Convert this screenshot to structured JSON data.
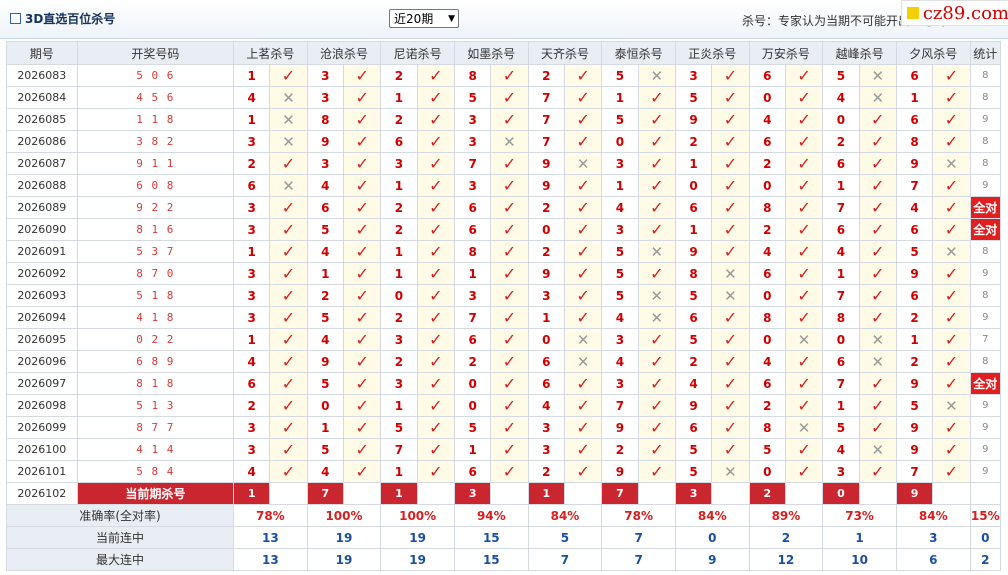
{
  "header": {
    "title": "3D直选百位杀号",
    "select_value": "近20期",
    "note": "杀号：专家认为当期不可能开出的号码",
    "logo_text": "cz89.com"
  },
  "columns": {
    "period": "期号",
    "draw": "开奖号码",
    "experts": [
      "上茗杀号",
      "沧浪杀号",
      "尼诺杀号",
      "如墨杀号",
      "天齐杀号",
      "泰恒杀号",
      "正炎杀号",
      "万安杀号",
      "越峰杀号",
      "夕风杀号"
    ],
    "count": "统计"
  },
  "rows": [
    {
      "period": "2026083",
      "draw": "5 0 6",
      "kills": [
        "1",
        "3",
        "2",
        "8",
        "2",
        "5",
        "3",
        "6",
        "5",
        "6"
      ],
      "hits": [
        1,
        1,
        1,
        1,
        1,
        0,
        1,
        1,
        0,
        1
      ],
      "count": "8"
    },
    {
      "period": "2026084",
      "draw": "4 5 6",
      "kills": [
        "4",
        "3",
        "1",
        "5",
        "7",
        "1",
        "5",
        "0",
        "4",
        "1"
      ],
      "hits": [
        0,
        1,
        1,
        1,
        1,
        1,
        1,
        1,
        0,
        1
      ],
      "count": "8"
    },
    {
      "period": "2026085",
      "draw": "1 1 8",
      "kills": [
        "1",
        "8",
        "2",
        "3",
        "7",
        "5",
        "9",
        "4",
        "0",
        "6"
      ],
      "hits": [
        0,
        1,
        1,
        1,
        1,
        1,
        1,
        1,
        1,
        1
      ],
      "count": "9"
    },
    {
      "period": "2026086",
      "draw": "3 8 2",
      "kills": [
        "3",
        "9",
        "6",
        "3",
        "7",
        "0",
        "2",
        "6",
        "2",
        "8"
      ],
      "hits": [
        0,
        1,
        1,
        0,
        1,
        1,
        1,
        1,
        1,
        1
      ],
      "count": "8"
    },
    {
      "period": "2026087",
      "draw": "9 1 1",
      "kills": [
        "2",
        "3",
        "3",
        "7",
        "9",
        "3",
        "1",
        "2",
        "6",
        "9"
      ],
      "hits": [
        1,
        1,
        1,
        1,
        0,
        1,
        1,
        1,
        1,
        0
      ],
      "count": "8"
    },
    {
      "period": "2026088",
      "draw": "6 0 8",
      "kills": [
        "6",
        "4",
        "1",
        "3",
        "9",
        "1",
        "0",
        "0",
        "1",
        "7"
      ],
      "hits": [
        0,
        1,
        1,
        1,
        1,
        1,
        1,
        1,
        1,
        1
      ],
      "count": "9"
    },
    {
      "period": "2026089",
      "draw": "9 2 2",
      "kills": [
        "3",
        "6",
        "2",
        "6",
        "2",
        "4",
        "6",
        "8",
        "7",
        "4"
      ],
      "hits": [
        1,
        1,
        1,
        1,
        1,
        1,
        1,
        1,
        1,
        1
      ],
      "count": "全对",
      "full": true
    },
    {
      "period": "2026090",
      "draw": "8 1 6",
      "kills": [
        "3",
        "5",
        "2",
        "6",
        "0",
        "3",
        "1",
        "2",
        "6",
        "6"
      ],
      "hits": [
        1,
        1,
        1,
        1,
        1,
        1,
        1,
        1,
        1,
        1
      ],
      "count": "全对",
      "full": true
    },
    {
      "period": "2026091",
      "draw": "5 3 7",
      "kills": [
        "1",
        "4",
        "1",
        "8",
        "2",
        "5",
        "9",
        "4",
        "4",
        "5"
      ],
      "hits": [
        1,
        1,
        1,
        1,
        1,
        0,
        1,
        1,
        1,
        0
      ],
      "count": "8"
    },
    {
      "period": "2026092",
      "draw": "8 7 0",
      "kills": [
        "3",
        "1",
        "1",
        "1",
        "9",
        "5",
        "8",
        "6",
        "1",
        "9"
      ],
      "hits": [
        1,
        1,
        1,
        1,
        1,
        1,
        0,
        1,
        1,
        1
      ],
      "count": "9"
    },
    {
      "period": "2026093",
      "draw": "5 1 8",
      "kills": [
        "3",
        "2",
        "0",
        "3",
        "3",
        "5",
        "5",
        "0",
        "7",
        "6"
      ],
      "hits": [
        1,
        1,
        1,
        1,
        1,
        0,
        0,
        1,
        1,
        1
      ],
      "count": "8"
    },
    {
      "period": "2026094",
      "draw": "4 1 8",
      "kills": [
        "3",
        "5",
        "2",
        "7",
        "1",
        "4",
        "6",
        "8",
        "8",
        "2"
      ],
      "hits": [
        1,
        1,
        1,
        1,
        1,
        0,
        1,
        1,
        1,
        1
      ],
      "count": "9"
    },
    {
      "period": "2026095",
      "draw": "0 2 2",
      "kills": [
        "1",
        "4",
        "3",
        "6",
        "0",
        "3",
        "5",
        "0",
        "0",
        "1"
      ],
      "hits": [
        1,
        1,
        1,
        1,
        0,
        1,
        1,
        0,
        0,
        1
      ],
      "count": "7"
    },
    {
      "period": "2026096",
      "draw": "6 8 9",
      "kills": [
        "4",
        "9",
        "2",
        "2",
        "6",
        "4",
        "2",
        "4",
        "6",
        "2"
      ],
      "hits": [
        1,
        1,
        1,
        1,
        0,
        1,
        1,
        1,
        0,
        1
      ],
      "count": "8"
    },
    {
      "period": "2026097",
      "draw": "8 1 8",
      "kills": [
        "6",
        "5",
        "3",
        "0",
        "6",
        "3",
        "4",
        "6",
        "7",
        "9"
      ],
      "hits": [
        1,
        1,
        1,
        1,
        1,
        1,
        1,
        1,
        1,
        1
      ],
      "count": "全对",
      "full": true
    },
    {
      "period": "2026098",
      "draw": "5 1 3",
      "kills": [
        "2",
        "0",
        "1",
        "0",
        "4",
        "7",
        "9",
        "2",
        "1",
        "5"
      ],
      "hits": [
        1,
        1,
        1,
        1,
        1,
        1,
        1,
        1,
        1,
        0
      ],
      "count": "9"
    },
    {
      "period": "2026099",
      "draw": "8 7 7",
      "kills": [
        "3",
        "1",
        "5",
        "5",
        "3",
        "9",
        "6",
        "8",
        "5",
        "9"
      ],
      "hits": [
        1,
        1,
        1,
        1,
        1,
        1,
        1,
        0,
        1,
        1
      ],
      "count": "9"
    },
    {
      "period": "2026100",
      "draw": "4 1 4",
      "kills": [
        "3",
        "5",
        "7",
        "1",
        "3",
        "2",
        "5",
        "5",
        "4",
        "9"
      ],
      "hits": [
        1,
        1,
        1,
        1,
        1,
        1,
        1,
        1,
        0,
        1
      ],
      "count": "9"
    },
    {
      "period": "2026101",
      "draw": "5 8 4",
      "kills": [
        "4",
        "4",
        "1",
        "6",
        "2",
        "9",
        "5",
        "0",
        "3",
        "7"
      ],
      "hits": [
        1,
        1,
        1,
        1,
        1,
        1,
        0,
        1,
        1,
        1
      ],
      "count": "9"
    }
  ],
  "current": {
    "period": "2026102",
    "label": "当前期杀号",
    "kills": [
      "1",
      "7",
      "1",
      "3",
      "1",
      "7",
      "3",
      "2",
      "0",
      "9"
    ]
  },
  "stats": {
    "accuracy_label": "准确率(全对率)",
    "accuracy": [
      "78%",
      "100%",
      "100%",
      "94%",
      "84%",
      "78%",
      "84%",
      "89%",
      "73%",
      "84%",
      "15%"
    ],
    "current_streak_label": "当前连中",
    "current_streak": [
      "13",
      "19",
      "19",
      "15",
      "5",
      "7",
      "0",
      "2",
      "1",
      "3",
      "0"
    ],
    "max_streak_label": "最大连中",
    "max_streak": [
      "13",
      "19",
      "19",
      "15",
      "7",
      "7",
      "9",
      "12",
      "10",
      "6",
      "2"
    ]
  },
  "icons": {
    "check": "check-icon",
    "cross": "cross-icon",
    "check_color": "#d81e1e",
    "cross_color": "#999999",
    "full_badge_color": "#e02020",
    "current_row_color": "#c9262f"
  }
}
